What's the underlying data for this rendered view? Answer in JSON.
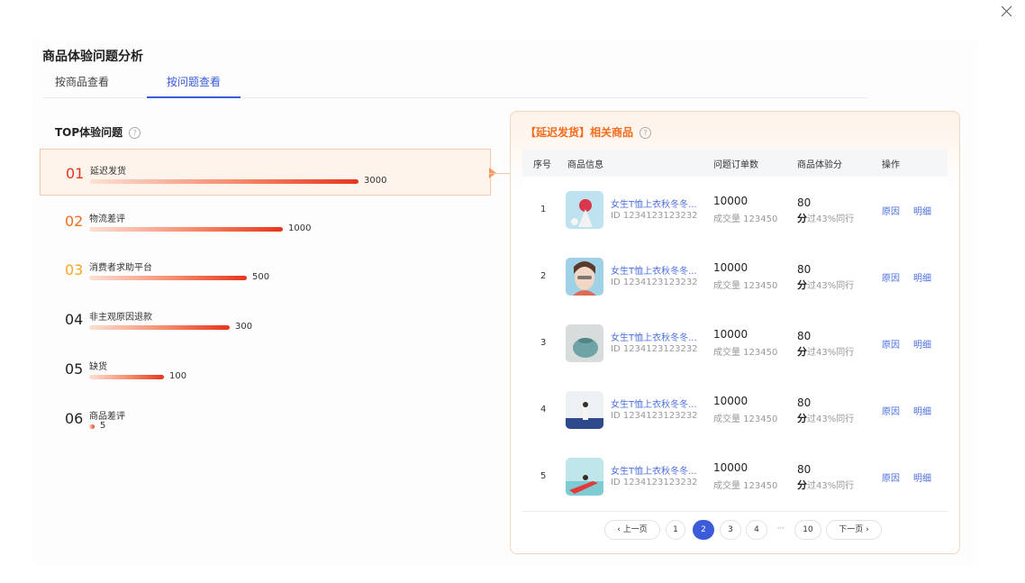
{
  "title": "商品体验问题分析",
  "tabs": [
    {
      "label": "按商品查看"
    },
    {
      "label": "按问题查看"
    }
  ],
  "left": {
    "heading": "TOP体验问题",
    "help": "?",
    "items": [
      {
        "rank": "01",
        "name": "延迟发货",
        "value": "3000",
        "num_color": "#e8341e"
      },
      {
        "rank": "02",
        "name": "物流差评",
        "value": "1000",
        "num_color": "#f26c1e"
      },
      {
        "rank": "03",
        "name": "消费者求助平台",
        "value": "500",
        "num_color": "#f5a623"
      },
      {
        "rank": "04",
        "name": "非主观原因退款",
        "value": "300",
        "num_color": "#222222"
      },
      {
        "rank": "05",
        "name": "缺货",
        "value": "100",
        "num_color": "#222222"
      },
      {
        "rank": "06",
        "name": "商品差评",
        "value": "5",
        "num_color": "#222222"
      }
    ]
  },
  "right": {
    "heading": "【延迟发货】相关商品",
    "help": "?",
    "columns": [
      "序号",
      "商品信息",
      "问题订单数",
      "商品体验分",
      "操作"
    ],
    "rows": [
      {
        "idx": "1",
        "name": "女生T恤上衣秋冬冬...",
        "id": "ID 1234123123232",
        "orders": "10000",
        "deal": "成交量 123450",
        "score": "80",
        "beat_prefix": "分",
        "beat": "过43%同行",
        "reason": "原因",
        "detail": "明细"
      },
      {
        "idx": "2",
        "name": "女生T恤上衣秋冬冬...",
        "id": "ID 1234123123232",
        "orders": "10000",
        "deal": "成交量 123450",
        "score": "80",
        "beat_prefix": "分",
        "beat": "过43%同行",
        "reason": "原因",
        "detail": "明细"
      },
      {
        "idx": "3",
        "name": "女生T恤上衣秋冬冬...",
        "id": "ID 1234123123232",
        "orders": "10000",
        "deal": "成交量 123450",
        "score": "80",
        "beat_prefix": "分",
        "beat": "过43%同行",
        "reason": "原因",
        "detail": "明细"
      },
      {
        "idx": "4",
        "name": "女生T恤上衣秋冬冬...",
        "id": "ID 1234123123232",
        "orders": "10000",
        "deal": "成交量 123450",
        "score": "80",
        "beat_prefix": "分",
        "beat": "过43%同行",
        "reason": "原因",
        "detail": "明细"
      },
      {
        "idx": "5",
        "name": "女生T恤上衣秋冬冬...",
        "id": "ID 1234123123232",
        "orders": "10000",
        "deal": "成交量 123450",
        "score": "80",
        "beat_prefix": "分",
        "beat": "过43%同行",
        "reason": "原因",
        "detail": "明细"
      }
    ],
    "pager": {
      "prev": "‹ 上一页",
      "pages": [
        "1",
        "2",
        "3",
        "4"
      ],
      "ellipsis": "···",
      "last": "10",
      "next": "下一页 ›",
      "current": "2"
    }
  },
  "colors": {
    "accent": "#3b5bdb",
    "orange": "#f26c1e",
    "bar_end": "#e8341e"
  }
}
